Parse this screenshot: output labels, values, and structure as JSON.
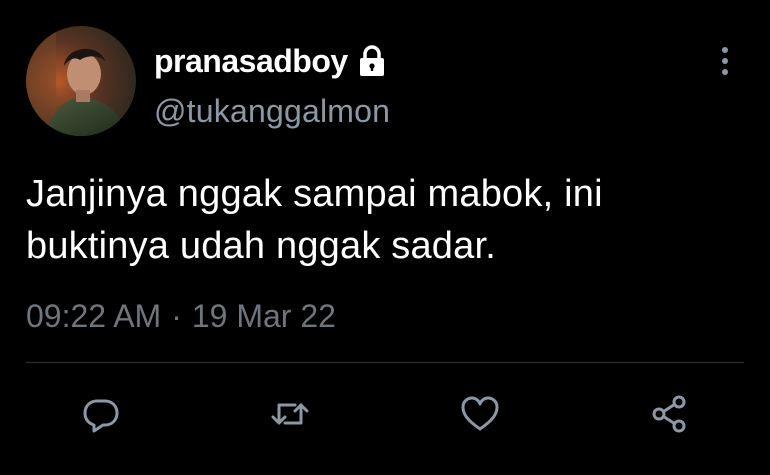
{
  "user": {
    "display_name": "pranasadboy",
    "handle": "@tukanggalmon",
    "protected_icon": "lock-icon"
  },
  "tweet": {
    "lines": [
      "Janjinya nggak sampai mabok, ini",
      "buktinya udah nggak sadar."
    ],
    "time": "09:22 AM",
    "separator": "·",
    "date": "19 Mar 22"
  },
  "actions": [
    {
      "icon": "reply-icon"
    },
    {
      "icon": "retweet-icon"
    },
    {
      "icon": "like-icon"
    },
    {
      "icon": "share-icon"
    }
  ],
  "colors": {
    "background": "#000000",
    "text": "#ffffff",
    "secondary_text": "#8b98a5",
    "icon": "#8b98a5"
  }
}
